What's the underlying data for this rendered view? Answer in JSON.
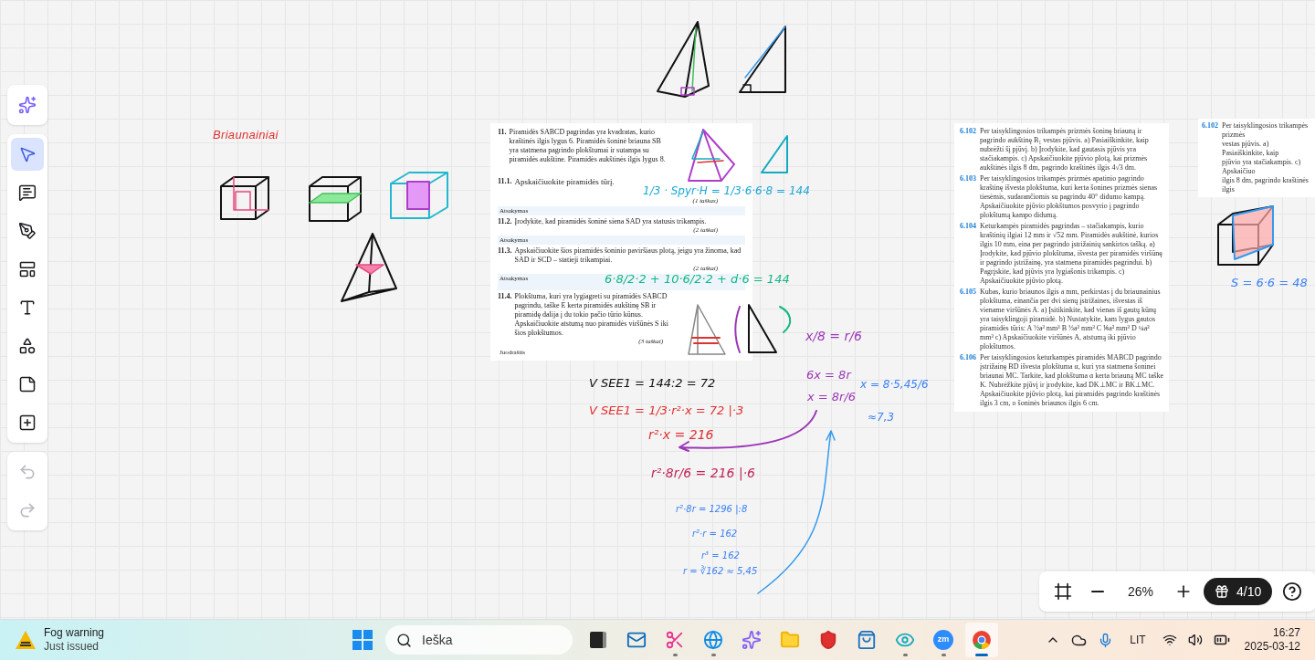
{
  "toolbar": {
    "assistant": {
      "kind": "sparkle",
      "selected": false
    },
    "tools": [
      {
        "kind": "pointer",
        "selected": true
      },
      {
        "kind": "comment",
        "selected": false
      },
      {
        "kind": "pen",
        "selected": false
      },
      {
        "kind": "layout",
        "selected": false
      },
      {
        "kind": "text",
        "selected": false
      },
      {
        "kind": "shapes",
        "selected": false
      },
      {
        "kind": "sticky",
        "selected": false
      },
      {
        "kind": "add",
        "selected": false
      }
    ],
    "history": [
      {
        "kind": "undo",
        "disabled": true
      },
      {
        "kind": "redo",
        "disabled": true
      }
    ]
  },
  "canvas": {
    "heading": "Briaunainiai",
    "worksheet": {
      "problems": [
        {
          "number": "11.",
          "text": "Piramidės SABCD pagrindas yra kvadratas, kurio kraštinės ilgis lygus 6. Piramidės šoninė briauna SB yra statmena pagrindo plokštumai ir sutampa su piramidės aukštine. Piramidės aukštinės ilgis lygus 8."
        },
        {
          "number": "11.1.",
          "text": "Apskaičiuokite piramidės tūrį.",
          "points": "(1 taškas)",
          "answer_label": "Atsakymas"
        },
        {
          "number": "11.2.",
          "text": "Įrodykite, kad piramidės šoninė siena SAD yra statusis trikampis.",
          "points": "(2 taškai)",
          "answer_label": "Atsakymas"
        },
        {
          "number": "11.3.",
          "text": "Apskaičiuokite šios piramidės šoninio paviršiaus plotą, jeigu yra žinoma, kad SAD ir SCD – statieji trikampiai.",
          "points": "(2 taškai)",
          "answer_label": "Atsakymas"
        },
        {
          "number": "11.4.",
          "text": "Plokštuma, kuri yra lygiagreti su piramidės SABCD pagrindu, taške E kerta piramidės aukštinę SB ir piramidę dalija į du tokio pačio tūrio kūnus. Apskaičiuokite atstumą nuo piramidės viršūnės S iki šios plokštumos.",
          "points": "(3 taškai)",
          "answer_label": "Juodraštis"
        }
      ]
    },
    "textbook": {
      "exercises": [
        {
          "number": "6.102",
          "text": "Per taisyklingosios trikampės prizmės šoninę briauną ir pagrindo aukštinę B₁ vestas pjūvis. a) Pasiaiškinkite, kaip nubrėžti šį pjūvį. b) Įrodykite, kad gautasis pjūvis yra stačiakampis. c) Apskaičiuokite pjūvio plotą, kai prizmės aukštinės ilgis 8 dm, pagrindo kraštinės ilgis 4√3 dm."
        },
        {
          "number": "6.103",
          "text": "Per taisyklingosios trikampės prizmės apatinio pagrindo kraštinę išvesta plokštuma, kuri kerta šonines prizmės sienas tiesėmis, sudarančiomis su pagrindu 40° didumo kampą. Apskaičiuokite pjūvio plokštumos posvyrio į pagrindo plokštumą kampo didumą."
        },
        {
          "number": "6.104",
          "text": "Keturkampės piramidės pagrindas – stačiakampis, kurio kraštinių ilgiai 12 mm ir √52 mm. Piramidės aukštinė, kurios ilgis 10 mm, eina per pagrindo įstrižainių sankirtos tašką. a) Įrodykite, kad pjūvio plokštuma, išvesta per piramidės viršūnę ir pagrindo įstrižainę, yra statmena piramidės pagrindui. b) Pagrįskite, kad pjūvis yra lygiašonis trikampis. c) Apskaičiuokite pjūvio plotą."
        },
        {
          "number": "6.105",
          "text": "Kubas, kurio briaunos ilgis a mm, perkirstas į du briaunainius plokštuma, einančia per dvi sienų įstrižaines, išvestas iš viename viršūnės A. a) Įsitikinkite, kad vienas iš gautų kūnų yra taisyklingoji piramidė. b) Nustatykite, kam lygus gautos piramidės tūris: A ½a³ mm³ B ⅓a³ mm³ C ⅙a³ mm³ D ¼a³ mm³ c) Apskaičiuokite viršūnės A, atstumą iki pjūvio plokštumos."
        },
        {
          "number": "6.106",
          "text": "Per taisyklingosios keturkampės piramidės MABCD pagrindo įstrižainę BD išvesta plokštuma α, kuri yra statmena šoninei briaunai MC. Tarkite, kad plokštuma α kerta briauną MC taške K. Nubrėžkite pjūvį ir įrodykite, kad DK⊥MC ir BK⊥MC. Apskaičiuokite pjūvio plotą, kai piramidės pagrindo kraštinės ilgis 3 cm, o šoninės briaunos ilgis 6 cm."
        }
      ]
    },
    "clipped_page": {
      "number": "6.102",
      "lines": [
        "Per taisyklingosios trikampės prizmės",
        "vestas pjūvis. a) Pasiaiškinkite, kaip",
        "pjūvio yra stačiakampis. c) Apskaičiuo",
        "ilgis 8 dm, pagrindo kraštinės ilgis"
      ]
    },
    "notes": [
      {
        "text": "1/3 · Spyr·H = 1/3·6·6·8 = 144",
        "color": "#1ba7d6"
      },
      {
        "text": "6·8/2·2 + 10·6/2·2 + d·6 = 144",
        "color": "#12b886"
      },
      {
        "text": "V SEE1 = 144:2 = 72",
        "color": "#111111"
      },
      {
        "text": "V SEE1 = 1/3·r²·x = 72 |·3",
        "color": "#e03131"
      },
      {
        "text": "r²·x = 216",
        "color": "#e03131"
      },
      {
        "text": "r²·8r/6 = 216 |·6",
        "color": "#c2255c"
      },
      {
        "text": "r²·8r = 1296 |:8",
        "color": "#3b82f6"
      },
      {
        "text": "r²·r = 162",
        "color": "#3b82f6"
      },
      {
        "text": "r³ = 162",
        "color": "#3b82f6"
      },
      {
        "text": "r = ∛162 ≈ 5,45",
        "color": "#3b82f6"
      },
      {
        "text": "x/8 = r/6",
        "color": "#9c36b5"
      },
      {
        "text": "6x = 8r",
        "color": "#9c36b5"
      },
      {
        "text": "x = 8r/6",
        "color": "#9c36b5"
      },
      {
        "text": "x = 8·5,45/6",
        "color": "#3b82f6"
      },
      {
        "text": "≈7,3",
        "color": "#3b82f6"
      },
      {
        "text": "S = 6·6 = 48",
        "color": "#3b82f6"
      }
    ]
  },
  "zoom_bar": {
    "level": "26%",
    "counter": "4/10"
  },
  "taskbar": {
    "weather": {
      "title": "Fog warning",
      "subtitle": "Just issued"
    },
    "search": {
      "placeholder": "Ieška"
    },
    "apps": [
      {
        "kind": "taskview",
        "running": false,
        "active": false
      },
      {
        "kind": "mail",
        "running": false,
        "active": false
      },
      {
        "kind": "scissors",
        "running": true,
        "active": false
      },
      {
        "kind": "browser",
        "running": true,
        "active": false
      },
      {
        "kind": "spark",
        "running": false,
        "active": false
      },
      {
        "kind": "folder",
        "running": false,
        "active": false
      },
      {
        "kind": "shield",
        "running": false,
        "active": false
      },
      {
        "kind": "store",
        "running": false,
        "active": false
      },
      {
        "kind": "eye",
        "running": true,
        "active": false
      },
      {
        "kind": "meeting",
        "label": "zm",
        "running": true,
        "active": false
      },
      {
        "kind": "chrome",
        "running": false,
        "active": true
      }
    ],
    "language": "LIT",
    "time": "16:27",
    "date": "2025-03-12"
  }
}
